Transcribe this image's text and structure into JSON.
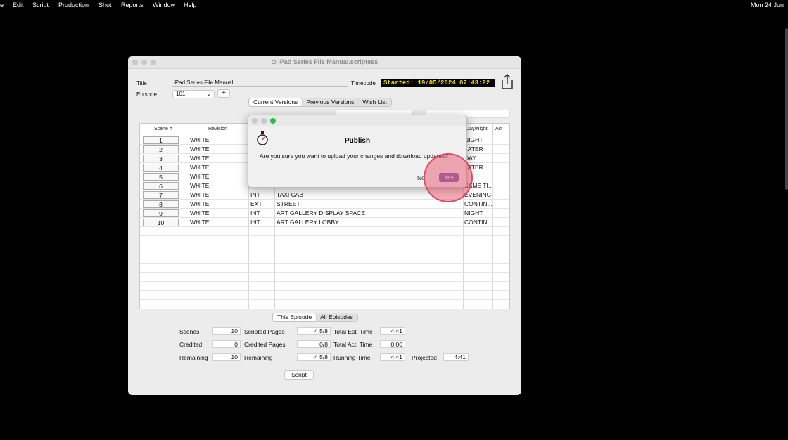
{
  "menubar": {
    "items": [
      "e",
      "Edit",
      "Script",
      "Production",
      "Shot",
      "Reports",
      "Window",
      "Help"
    ],
    "clock": "Mon 24 Jun"
  },
  "window": {
    "title": "iPad Series File Manual.scriptess",
    "title_label": "Title",
    "title_value": "iPad Series File Manual",
    "timecode_label": "Timecode",
    "timecode_value": "Started: 19/05/2024 07:43:22",
    "episode_label": "Episode",
    "episode_value": "101",
    "plus": "+"
  },
  "tabs": [
    "Current Versions",
    "Previous Versions",
    "Wish List"
  ],
  "table": {
    "headers": [
      "Scene #",
      "Revision",
      "Day/Night",
      "Act"
    ],
    "rows": [
      {
        "scene": "1",
        "revision": "WHITE",
        "intext": "",
        "location": "",
        "daynight": "NIGHT"
      },
      {
        "scene": "2",
        "revision": "WHITE",
        "intext": "",
        "location": "",
        "daynight": "LATER"
      },
      {
        "scene": "3",
        "revision": "WHITE",
        "intext": "",
        "location": "",
        "daynight": "DAY"
      },
      {
        "scene": "4",
        "revision": "WHITE",
        "intext": "",
        "location": "",
        "daynight": "LATER"
      },
      {
        "scene": "5",
        "revision": "WHITE",
        "intext": "",
        "location": "",
        "daynight": ""
      },
      {
        "scene": "6",
        "revision": "WHITE",
        "intext": "",
        "location": "",
        "daynight": "SAME TI..."
      },
      {
        "scene": "7",
        "revision": "WHITE",
        "intext": "INT",
        "location": "TAXI CAB",
        "daynight": "EVENING"
      },
      {
        "scene": "8",
        "revision": "WHITE",
        "intext": "EXT",
        "location": "STREET",
        "daynight": "CONTIN..."
      },
      {
        "scene": "9",
        "revision": "WHITE",
        "intext": "INT",
        "location": "ART GALLERY DISPLAY SPACE",
        "daynight": "NIGHT"
      },
      {
        "scene": "10",
        "revision": "WHITE",
        "intext": "INT",
        "location": "ART GALLERY LOBBY",
        "daynight": "CONTIN..."
      }
    ]
  },
  "episode_tabs": [
    "This Episode",
    "All Episodes"
  ],
  "stats": {
    "scenes_label": "Scenes",
    "scenes": "10",
    "credited_label": "Credited",
    "credited": "0",
    "remaining_label": "Remaining",
    "remaining": "10",
    "scripted_pages_label": "Scripted Pages",
    "scripted_pages": "4 5/8",
    "credited_pages_label": "Credited Pages",
    "credited_pages": "0/8",
    "remaining_pages_label": "Remaining",
    "remaining_pages": "4 5/8",
    "total_est_label": "Total Est. Time",
    "total_est": "4:41",
    "total_act_label": "Total Act. Time",
    "total_act": "0:00",
    "running_label": "Running Time",
    "running": "4:41",
    "projected_label": "Projected",
    "projected": "4:41"
  },
  "script_button": "Script",
  "dialog": {
    "title": "Publish",
    "message": "Are you sure you want to upload your changes and download updates?",
    "no": "No",
    "yes": "Yes"
  },
  "colors": {
    "timecode_bg": "#000000",
    "timecode_fg": "#f3e000",
    "yes_button": "#8b68b4",
    "cursor_highlight": "#e64664"
  }
}
